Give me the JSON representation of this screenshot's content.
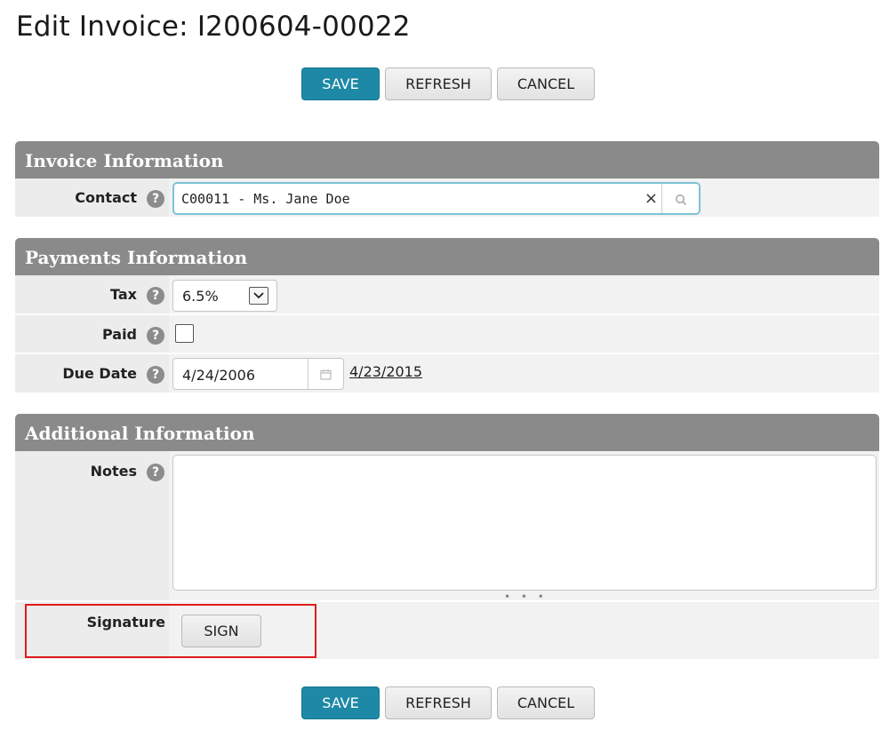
{
  "page": {
    "title": "Edit Invoice: I200604-00022"
  },
  "buttons": {
    "save": "SAVE",
    "refresh": "REFRESH",
    "cancel": "CANCEL",
    "sign": "SIGN"
  },
  "invoice_information": {
    "header": "Invoice Information",
    "contact_label": "Contact",
    "contact_value": "C00011 - Ms. Jane Doe",
    "clear_glyph": "×",
    "search_icon": "search-icon"
  },
  "payments_information": {
    "header": "Payments Information",
    "tax_label": "Tax",
    "tax_value": "6.5%",
    "paid_label": "Paid",
    "paid_checked": false,
    "due_date_label": "Due Date",
    "due_date_value": "4/24/2006",
    "due_date_link": "4/23/2015"
  },
  "additional_information": {
    "header": "Additional Information",
    "notes_label": "Notes",
    "notes_value": "",
    "signature_label": "Signature"
  },
  "help_glyph": "?",
  "colors": {
    "primary": "#1e89a6",
    "section_header": "#8a8a8a",
    "highlight": "#e11b1b",
    "focus_border": "#7ec3d6"
  }
}
